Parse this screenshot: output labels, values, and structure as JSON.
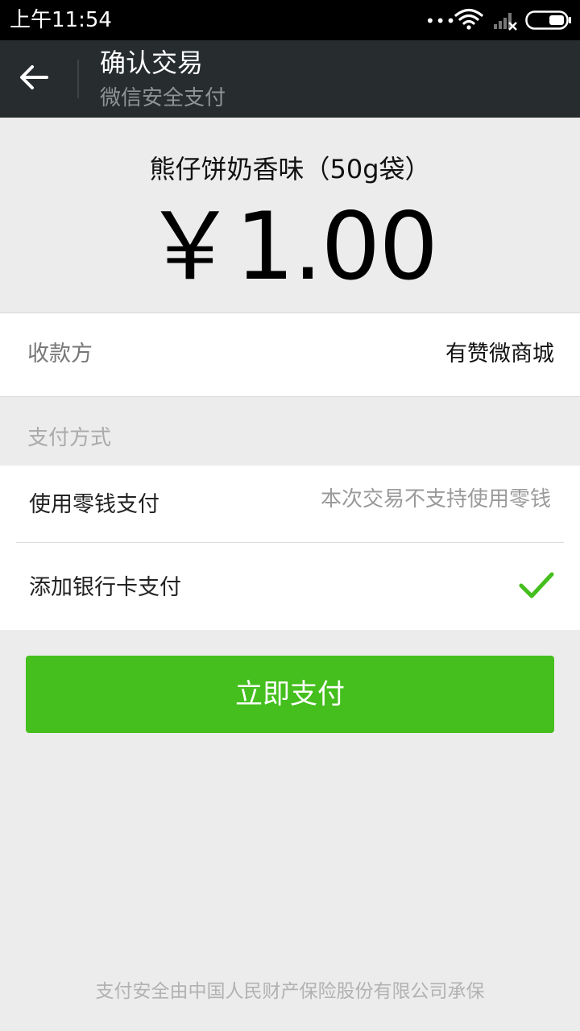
{
  "status_bar": {
    "time": "上午11:54",
    "dots": "•••"
  },
  "header": {
    "title": "确认交易",
    "subtitle": "微信安全支付"
  },
  "product": {
    "name": "熊仔饼奶香味（50g袋）",
    "price": "￥1.00"
  },
  "payee": {
    "label": "收款方",
    "value": "有赞微商城"
  },
  "payment": {
    "heading": "支付方式",
    "methods": [
      {
        "label": "使用零钱支付",
        "note": "本次交易不支持使用零钱",
        "selected": false
      },
      {
        "label": "添加银行卡支付",
        "note": "",
        "selected": true
      }
    ]
  },
  "pay_button": {
    "label": "立即支付"
  },
  "footer": {
    "text": "支付安全由中国人民财产保险股份有限公司承保"
  },
  "colors": {
    "accent": "#44bf1d",
    "titlebar": "#272d2f",
    "background": "#ececec"
  }
}
